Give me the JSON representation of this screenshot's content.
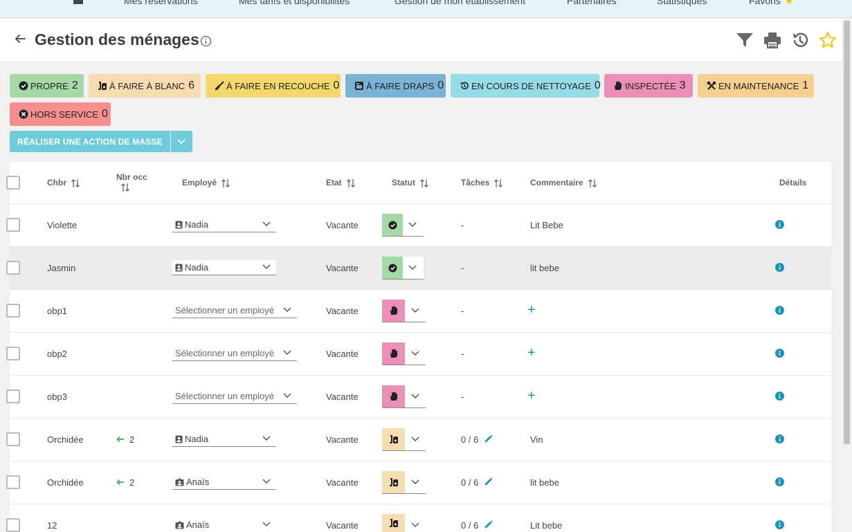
{
  "nav": {
    "items": [
      "Mes réservations",
      "Mes tarifs et disponibilités",
      "Gestion de mon établissement",
      "Partenaires",
      "Statistiques",
      "Favoris"
    ]
  },
  "header": {
    "title": "Gestion des ménages"
  },
  "chips": [
    {
      "label": "PROPRE",
      "count": "2",
      "color": "#a5d9a7",
      "icon": "check-circle-icon"
    },
    {
      "label": "À FAIRE À BLANC",
      "count": "6",
      "color": "#f7dcb2",
      "icon": "vacuum-icon"
    },
    {
      "label": "À FAIRE EN RECOUCHE",
      "count": "0",
      "color": "#f5d86b",
      "icon": "broom-icon"
    },
    {
      "label": "À FAIRE DRAPS",
      "count": "0",
      "color": "#7ab3d6",
      "icon": "sheets-icon"
    },
    {
      "label": "EN COURS DE NETTOYAGE",
      "count": "0",
      "color": "#95dce6",
      "icon": "history-icon"
    },
    {
      "label": "INSPECTÉE",
      "count": "3",
      "color": "#ec8fb7",
      "icon": "hand-icon"
    },
    {
      "label": "EN MAINTENANCE",
      "count": "1",
      "color": "#f5cf8e",
      "icon": "tools-icon"
    },
    {
      "label": "HORS SERVICE",
      "count": "0",
      "color": "#f58f8f",
      "icon": "times-circle-icon"
    }
  ],
  "mass_action": {
    "label": "RÉALISER UNE ACTION DE MASSE"
  },
  "table": {
    "headers": [
      "Chbr",
      "Nbr occ",
      "Employé",
      "Etat",
      "Statut",
      "Tâches",
      "Commentaire",
      "Détails"
    ],
    "rows": [
      {
        "room": "Violette",
        "occ": "",
        "employee": "Nadia",
        "employee_icon": "id-badge-icon",
        "state": "Vacante",
        "status": "propre",
        "tasks": "-",
        "comment": "Lit Bebe",
        "highlight": false
      },
      {
        "room": "Jasmin",
        "occ": "",
        "employee": "Nadia",
        "employee_icon": "id-badge-icon",
        "state": "Vacante",
        "status": "propre",
        "tasks": "-",
        "comment": "lit bebe",
        "highlight": true
      },
      {
        "room": "obp1",
        "occ": "",
        "employee": "",
        "employee_placeholder": "Sélectionner un employé",
        "state": "Vacante",
        "status": "inspectee",
        "tasks": "-",
        "comment": "",
        "highlight": false
      },
      {
        "room": "obp2",
        "occ": "",
        "employee": "",
        "employee_placeholder": "Sélectionner un employé",
        "state": "Vacante",
        "status": "inspectee",
        "tasks": "-",
        "comment": "",
        "highlight": false
      },
      {
        "room": "obp3",
        "occ": "",
        "employee": "",
        "employee_placeholder": "Sélectionner un employé",
        "state": "Vacante",
        "status": "inspectee",
        "tasks": "-",
        "comment": "",
        "highlight": false
      },
      {
        "room": "Orchidée",
        "occ": "2",
        "employee": "Nadia",
        "employee_icon": "id-badge-icon",
        "state": "Vacante",
        "status": "a-faire-a-blanc",
        "tasks": "0 / 6",
        "comment": "Vin",
        "highlight": false
      },
      {
        "room": "Orchidée",
        "occ": "2",
        "employee": "Anaïs",
        "employee_icon": "id-card-icon",
        "state": "Vacante",
        "status": "a-faire-a-blanc",
        "tasks": "0 / 6",
        "comment": "lit bebe",
        "highlight": false
      },
      {
        "room": "12",
        "occ": "",
        "employee": "Anaïs",
        "employee_icon": "id-card-icon",
        "state": "Vacante",
        "status": "a-faire-a-blanc",
        "tasks": "0 / 6",
        "comment": "Lit bebe",
        "highlight": false
      }
    ]
  },
  "colors": {
    "accent": "#6dcbdc",
    "link": "#1f93b5",
    "status_propre": "#a5d9a7",
    "status_inspectee": "#ec8fb7",
    "status_a_faire_a_blanc": "#f7dcb2",
    "star": "#f1c40f"
  }
}
